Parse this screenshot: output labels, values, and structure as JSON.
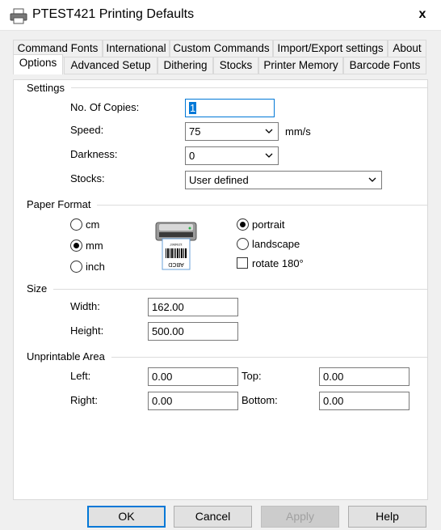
{
  "window": {
    "title": "PTEST421 Printing Defaults",
    "close_glyph": "x"
  },
  "tabs_top": [
    {
      "label": "Command Fonts"
    },
    {
      "label": "International"
    },
    {
      "label": "Custom Commands"
    },
    {
      "label": "Import/Export settings"
    },
    {
      "label": "About"
    }
  ],
  "tabs_bottom": [
    {
      "label": "Options",
      "active": true
    },
    {
      "label": "Advanced Setup"
    },
    {
      "label": "Dithering"
    },
    {
      "label": "Stocks"
    },
    {
      "label": "Printer Memory"
    },
    {
      "label": "Barcode Fonts"
    }
  ],
  "settings": {
    "group_label": "Settings",
    "copies_label": "No. Of Copies:",
    "copies_value": "1",
    "speed_label": "Speed:",
    "speed_value": "75",
    "speed_unit": "mm/s",
    "darkness_label": "Darkness:",
    "darkness_value": "0",
    "stocks_label": "Stocks:",
    "stocks_value": "User defined"
  },
  "paper_format": {
    "group_label": "Paper Format",
    "units": [
      {
        "label": "cm",
        "checked": false
      },
      {
        "label": "mm",
        "checked": true
      },
      {
        "label": "inch",
        "checked": false
      }
    ],
    "orientation": [
      {
        "label": "portrait",
        "checked": true
      },
      {
        "label": "landscape",
        "checked": false
      }
    ],
    "rotate_label": "rotate 180°",
    "rotate_checked": false,
    "preview_text": "ABCD",
    "preview_num": "1234567"
  },
  "size": {
    "group_label": "Size",
    "width_label": "Width:",
    "width_value": "162.00",
    "height_label": "Height:",
    "height_value": "500.00"
  },
  "unprintable": {
    "group_label": "Unprintable Area",
    "left_label": "Left:",
    "left_value": "0.00",
    "top_label": "Top:",
    "top_value": "0.00",
    "right_label": "Right:",
    "right_value": "0.00",
    "bottom_label": "Bottom:",
    "bottom_value": "0.00"
  },
  "buttons": {
    "ok": "OK",
    "cancel": "Cancel",
    "apply": "Apply",
    "help": "Help"
  },
  "colors": {
    "accent": "#0078d7",
    "dialog_bg": "#f0f0f0",
    "panel_bg": "#ffffff"
  }
}
